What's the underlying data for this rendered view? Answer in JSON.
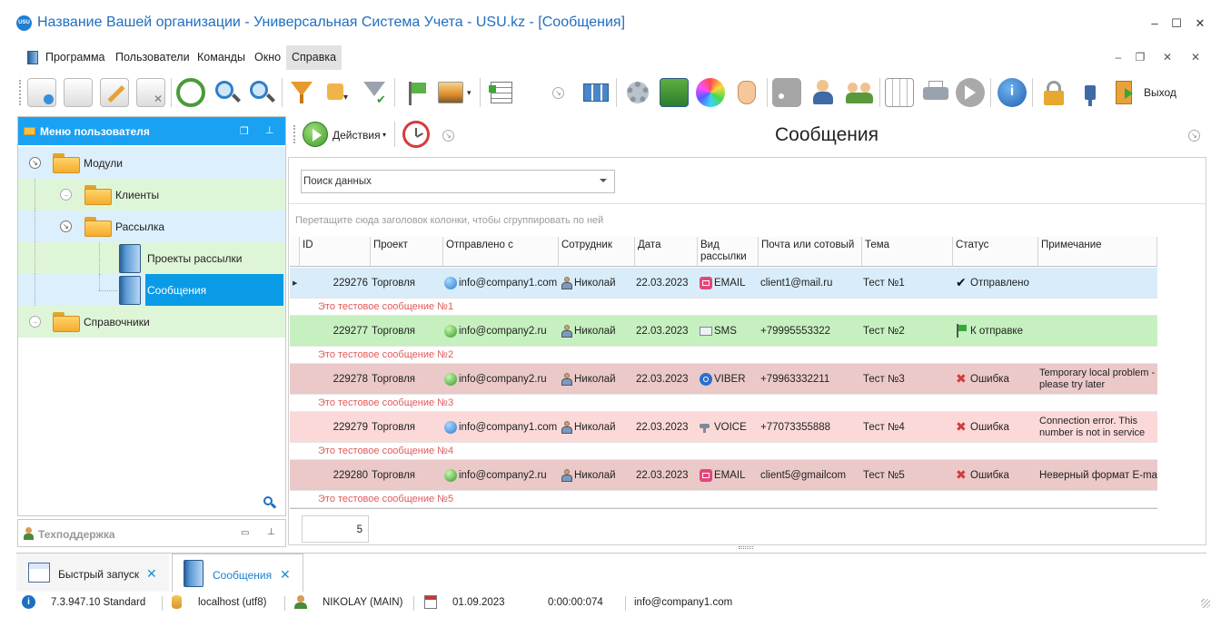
{
  "window": {
    "title": "Название Вашей организации - Универсальная Система Учета - USU.kz - [Сообщения]",
    "logo_text": "USU"
  },
  "menubar": {
    "items": [
      "Программа",
      "Пользователи",
      "Команды",
      "Окно",
      "Справка"
    ],
    "active": "Справка"
  },
  "toolbar": {
    "exit_label": "Выход"
  },
  "user_menu": {
    "title": "Меню пользователя",
    "tree": [
      {
        "label": "Модули"
      },
      {
        "label": "Клиенты"
      },
      {
        "label": "Рассылка"
      },
      {
        "label": "Проекты рассылки"
      },
      {
        "label": "Сообщения"
      },
      {
        "label": "Справочники"
      }
    ]
  },
  "support": {
    "label": "Техподдержка"
  },
  "main": {
    "actions_label": "Действия",
    "page_title": "Сообщения",
    "search_placeholder": "Поиск данных",
    "group_hint": "Перетащите сюда заголовок колонки, чтобы сгруппировать по ней",
    "footer_count": "5"
  },
  "table": {
    "columns": [
      "ID",
      "Проект",
      "Отправлено с",
      "Сотрудник",
      "Дата",
      "Вид рассылки",
      "Почта или сотовый",
      "Тема",
      "Статус",
      "Примечание"
    ],
    "rows": [
      {
        "id": "229276",
        "project": "Торговля",
        "from": "info@company1.com",
        "employee": "Николай",
        "date": "22.03.2023",
        "type": "EMAIL",
        "contact": "client1@mail.ru",
        "subject": "Тест №1",
        "status": "Отправлено",
        "note": "",
        "message": "Это тестовое сообщение №1",
        "bg": "#d9ecfa"
      },
      {
        "id": "229277",
        "project": "Торговля",
        "from": "info@company2.ru",
        "employee": "Николай",
        "date": "22.03.2023",
        "type": "SMS",
        "contact": "+79995553322",
        "subject": "Тест №2",
        "status": "К отправке",
        "note": "",
        "message": "Это тестовое сообщение №2",
        "bg": "#c6f0bf"
      },
      {
        "id": "229278",
        "project": "Торговля",
        "from": "info@company2.ru",
        "employee": "Николай",
        "date": "22.03.2023",
        "type": "VIBER",
        "contact": "+79963332211",
        "subject": "Тест №3",
        "status": "Ошибка",
        "note": "Temporary local problem - please try later",
        "message": "Это тестовое сообщение №3",
        "bg": "#ebc9c9"
      },
      {
        "id": "229279",
        "project": "Торговля",
        "from": "info@company1.com",
        "employee": "Николай",
        "date": "22.03.2023",
        "type": "VOICE",
        "contact": "+77073355888",
        "subject": "Тест №4",
        "status": "Ошибка",
        "note": "Connection error. This number is not in service",
        "message": "Это тестовое сообщение №4",
        "bg": "#fbd9d9"
      },
      {
        "id": "229280",
        "project": "Торговля",
        "from": "info@company2.ru",
        "employee": "Николай",
        "date": "22.03.2023",
        "type": "EMAIL",
        "contact": "client5@gmailcom",
        "subject": "Тест №5",
        "status": "Ошибка",
        "note": "Неверный формат E-mail",
        "message": "Это тестовое сообщение №5",
        "bg": "#ebc9c9"
      }
    ]
  },
  "tabs": [
    {
      "label": "Быстрый запуск"
    },
    {
      "label": "Сообщения"
    }
  ],
  "statusbar": {
    "version": "7.3.947.10 Standard",
    "db": "localhost (utf8)",
    "user": "NIKOLAY (MAIN)",
    "date": "01.09.2023",
    "timer": "0:00:00:074",
    "email": "info@company1.com"
  },
  "colors": {
    "accent": "#1ba1f2",
    "title_text": "#1f6fc1",
    "message_text": "#e05a5a"
  }
}
